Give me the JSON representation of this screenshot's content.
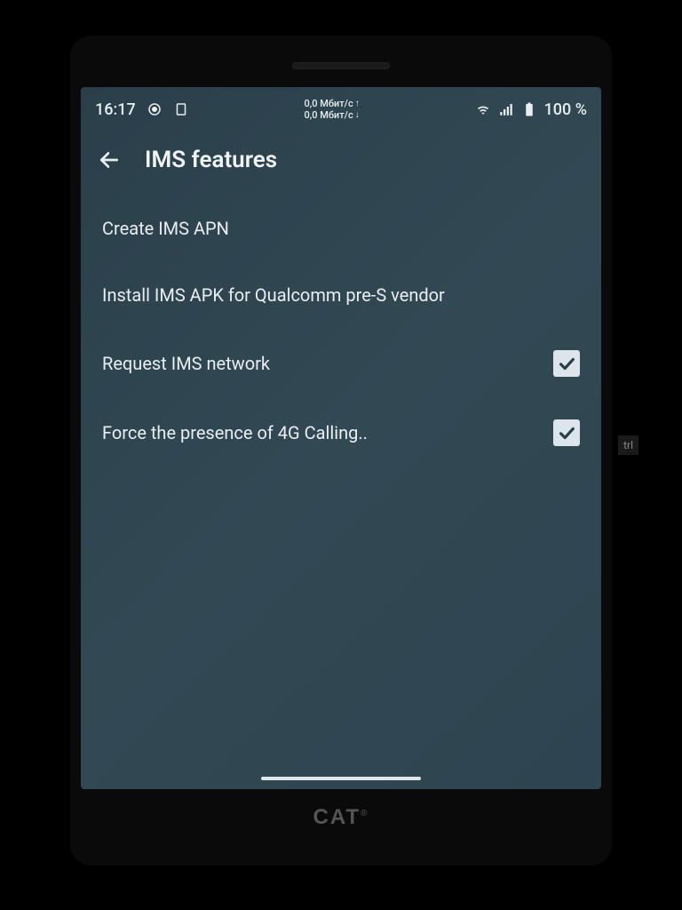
{
  "status_bar": {
    "time": "16:17",
    "net_up": "0,0 Мбит/с",
    "net_down": "0,0 Мбит/с",
    "battery": "100 %"
  },
  "header": {
    "title": "IMS features"
  },
  "settings": [
    {
      "label": "Create IMS APN",
      "has_checkbox": false
    },
    {
      "label": "Install IMS APK for Qualcomm pre-S vendor",
      "has_checkbox": false
    },
    {
      "label": "Request IMS network",
      "has_checkbox": true,
      "checked": true
    },
    {
      "label": "Force the presence of 4G Calling..",
      "has_checkbox": true,
      "checked": true
    }
  ],
  "brand": "CAT",
  "side_text": "trl"
}
